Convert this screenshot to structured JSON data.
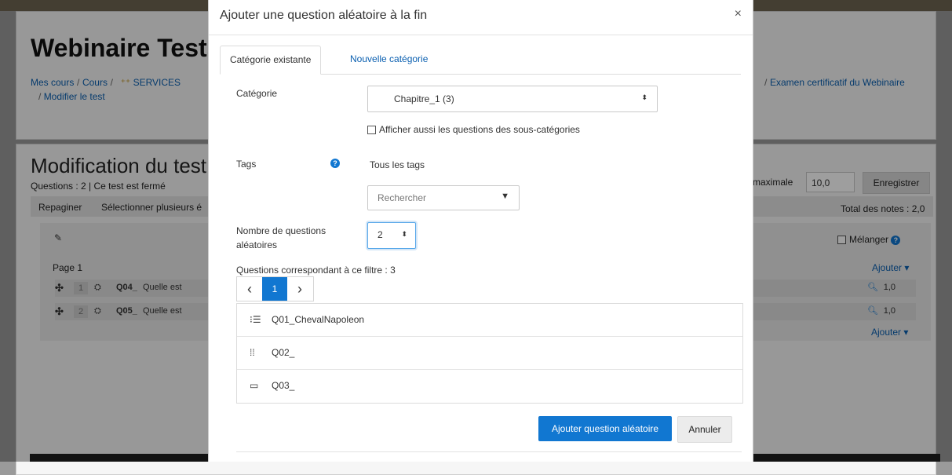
{
  "background": {
    "course_title": "Webinaire Tests e",
    "breadcrumb": {
      "mes_cours": "Mes cours",
      "cours": "Cours",
      "services": "SERVICES",
      "right_item": "Examen certificatif du Webinaire",
      "modifier": "Modifier le test",
      "sep": "/"
    },
    "edit_title": "Modification du test E",
    "questions_status": "Questions : 2 | Ce test est fermé",
    "repaginer": "Repaginer",
    "select_multiple": "Sélectionner plusieurs é",
    "note_max_label": "e maximale",
    "note_max_value": "10,0",
    "save_label": "Enregistrer",
    "total_notes": "Total des notes : 2,0",
    "shuffle_label": "Mélanger",
    "page_label": "Page 1",
    "add_label": "Ajouter",
    "questions": [
      {
        "number": "1",
        "name": "Q04_",
        "text": "Quelle est",
        "mark": "1,0"
      },
      {
        "number": "2",
        "name": "Q05_",
        "text": "Quelle est",
        "mark": "1,0"
      }
    ],
    "colors": {
      "link": "#0a5fb0",
      "accent": "#1177d1"
    }
  },
  "modal": {
    "title": "Ajouter une question aléatoire à la fin",
    "close_label": "×",
    "tabs": [
      {
        "label": "Catégorie existante",
        "active": true
      },
      {
        "label": "Nouvelle catégorie",
        "active": false
      }
    ],
    "category_label": "Catégorie",
    "category_value": "Chapitre_1 (3)",
    "subcategories_label": "Afficher aussi les questions des sous-catégories",
    "tags_label": "Tags",
    "tags_value": "Tous les tags",
    "tags_search_placeholder": "Rechercher",
    "count_label_line1": "Nombre de questions",
    "count_label_line2": "aléatoires",
    "count_value": "2",
    "matching_label": "Questions correspondant à ce filtre : 3",
    "pager": {
      "prev": "‹",
      "current": "1",
      "next": "›"
    },
    "questions": [
      {
        "icon": "multichoice-icon",
        "name": "Q01_ChevalNapoleon"
      },
      {
        "icon": "matching-icon",
        "name": "Q02_"
      },
      {
        "icon": "shortanswer-icon",
        "name": "Q03_"
      }
    ],
    "add_button": "Ajouter question aléatoire",
    "cancel_button": "Annuler"
  }
}
